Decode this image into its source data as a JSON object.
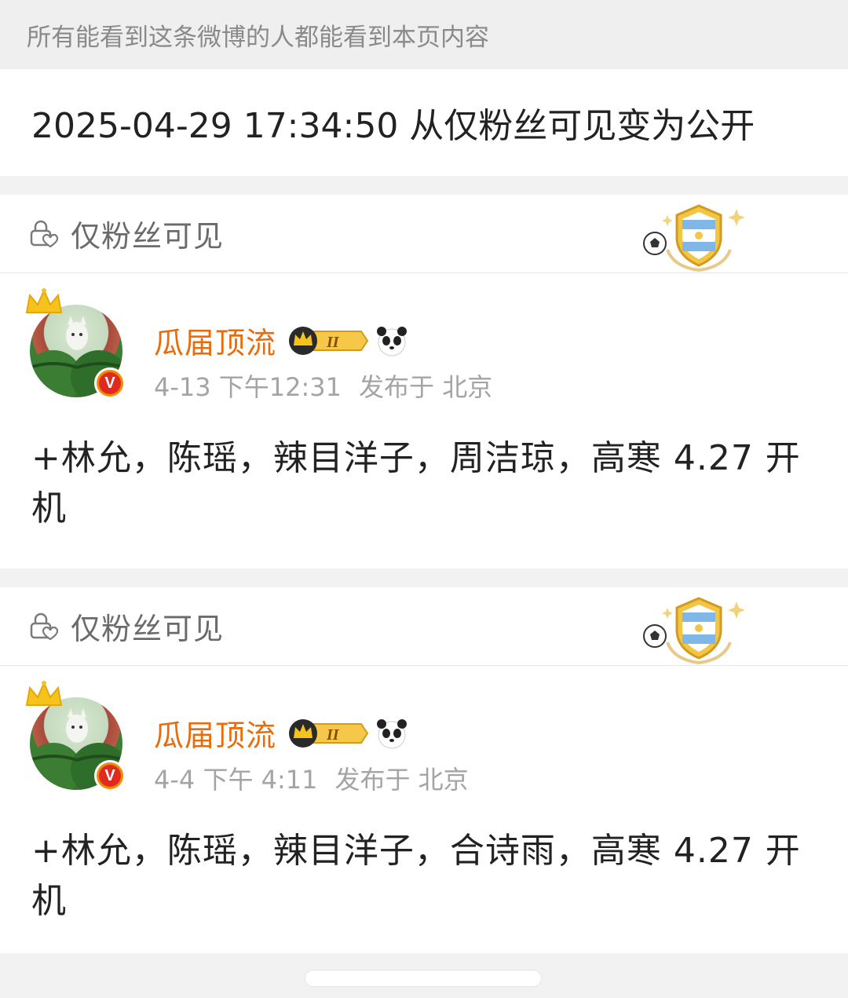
{
  "notice": "所有能看到这条微博的人都能看到本页内容",
  "change_log": "2025-04-29 17:34:50 从仅粉丝可见变为公开",
  "posts": [
    {
      "visibility": "仅粉丝可见",
      "username": "瓜届顶流",
      "date": "4-13 下午12:31",
      "location": "发布于 北京",
      "content": "+林允，陈瑶，辣目洋子，周洁琼，高寒 4.27 开机"
    },
    {
      "visibility": "仅粉丝可见",
      "username": "瓜届顶流",
      "date": "4-4 下午 4:11",
      "location": "发布于 北京",
      "content": "+林允，陈瑶，辣目洋子，合诗雨，高寒 4.27 开机"
    }
  ],
  "vip_level": "II",
  "verified_mark": "V",
  "colors": {
    "username": "#e86b0c",
    "meta": "#a4a4a4",
    "notice": "#8a8a8a",
    "verified": "#e02a1f"
  },
  "icons": [
    "lock-icon",
    "football-badge-icon",
    "crown-icon",
    "verified-icon",
    "vip-crown-icon",
    "panda-icon"
  ]
}
